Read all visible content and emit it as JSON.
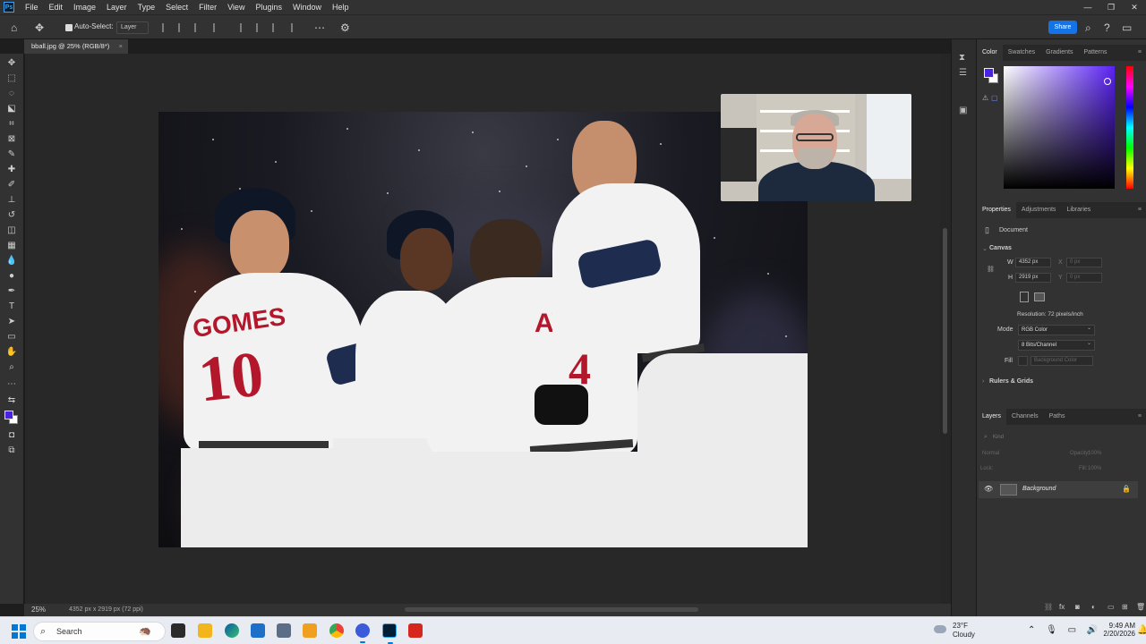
{
  "menubar": {
    "app_logo": "Ps",
    "items": [
      "File",
      "Edit",
      "Image",
      "Layer",
      "Type",
      "Select",
      "Filter",
      "View",
      "Plugins",
      "Window",
      "Help"
    ],
    "window_controls": [
      "—",
      "❐",
      "✕"
    ]
  },
  "options_bar": {
    "auto_select_label": "Auto-Select:",
    "auto_select_checked": true,
    "target_select": "Layer",
    "share_label": "Share"
  },
  "document_tab": {
    "title": "bball.jpg @ 25% (RGB/8*)",
    "close": "×"
  },
  "photo": {
    "player1_name": "GOMES",
    "player1_number": "10",
    "player2_name": "AVILES",
    "player2_number": "4"
  },
  "status_bar": {
    "zoom": "25%",
    "doc_info": "4352 px x 2919 px (72 ppi)"
  },
  "color_panel": {
    "tabs": [
      "Color",
      "Swatches",
      "Gradients",
      "Patterns"
    ],
    "active_tab": "Color",
    "foreground_color": "#4b22e0",
    "background_color": "#ffffff"
  },
  "properties_panel": {
    "tabs": [
      "Properties",
      "Adjustments",
      "Libraries"
    ],
    "active_tab": "Properties",
    "doc_type": "Document",
    "canvas_section": "Canvas",
    "width_label": "W",
    "width_value": "4352 px",
    "height_label": "H",
    "height_value": "2919 px",
    "x_label": "X",
    "x_placeholder": "0 px",
    "y_label": "Y",
    "y_placeholder": "0 px",
    "resolution": "Resolution: 72 pixels/inch",
    "mode_label": "Mode",
    "mode_value": "RGB Color",
    "bits_value": "8 Bits/Channel",
    "fill_label": "Fill",
    "fill_value": "Background Color",
    "rulers_section": "Rulers & Grids"
  },
  "layers_panel": {
    "tabs": [
      "Layers",
      "Channels",
      "Paths"
    ],
    "active_tab": "Layers",
    "kind_placeholder": "Kind",
    "blend_mode": "Normal",
    "opacity_label": "Opacity:",
    "opacity_value": "100%",
    "lock_label": "Lock:",
    "fill_label": "Fill:",
    "fill_value": "100%",
    "layers": [
      {
        "name": "Background",
        "visible": true,
        "locked": true
      }
    ]
  },
  "taskbar": {
    "search_label": "Search",
    "weather_temp": "23°F",
    "weather_cond": "Cloudy",
    "time": "9:49 AM",
    "date": "2/20/2026"
  }
}
